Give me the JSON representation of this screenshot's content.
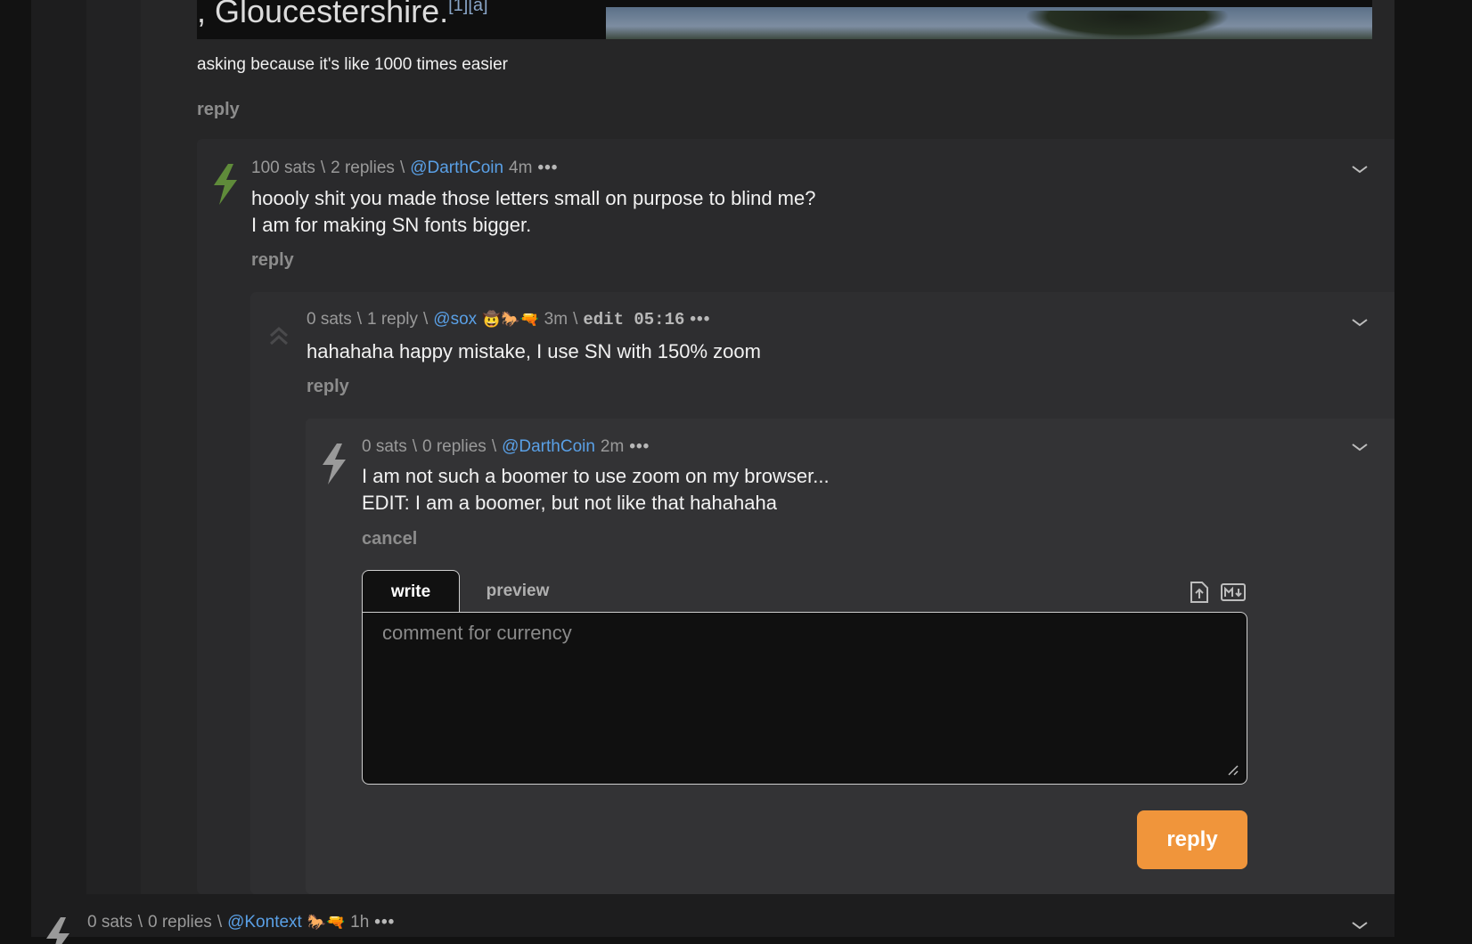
{
  "embedded_image": {
    "caption": ", Gloucestershire.",
    "footnote": "[1][a]"
  },
  "top_comment": {
    "text": "asking because it's like 1000 times easier",
    "reply_label": "reply"
  },
  "comment1": {
    "sats": "100 sats",
    "replies": "2 replies",
    "user": "@DarthCoin",
    "time": "4m",
    "line1": "hoooly shit you made those letters small on purpose to blind me?",
    "line2": "I am for making SN fonts bigger.",
    "reply_label": "reply",
    "bolt_color": "#5f8b3a"
  },
  "comment2": {
    "sats": "0 sats",
    "replies": "1 reply",
    "user": "@sox",
    "badges": "🤠🐎🔫",
    "time": "3m",
    "edit": "edit 05:16",
    "text": "hahahaha happy mistake, I use SN with 150% zoom",
    "reply_label": "reply"
  },
  "comment3": {
    "sats": "0 sats",
    "replies": "0 replies",
    "user": "@DarthCoin",
    "time": "2m",
    "line1": "I am not such a boomer to use zoom on my browser...",
    "line2": "EDIT: I am a boomer, but not like that hahahaha",
    "cancel_label": "cancel"
  },
  "editor": {
    "tab_write": "write",
    "tab_preview": "preview",
    "placeholder": "comment for currency",
    "submit_label": "reply"
  },
  "bottom_comment": {
    "sats": "0 sats",
    "replies": "0 replies",
    "user": "@Kontext",
    "badges": "🐎🔫",
    "time": "1h"
  },
  "separator": "\\",
  "more_dots": "•••",
  "colors": {
    "accent": "#f0953b",
    "link": "#5aa0e6"
  }
}
